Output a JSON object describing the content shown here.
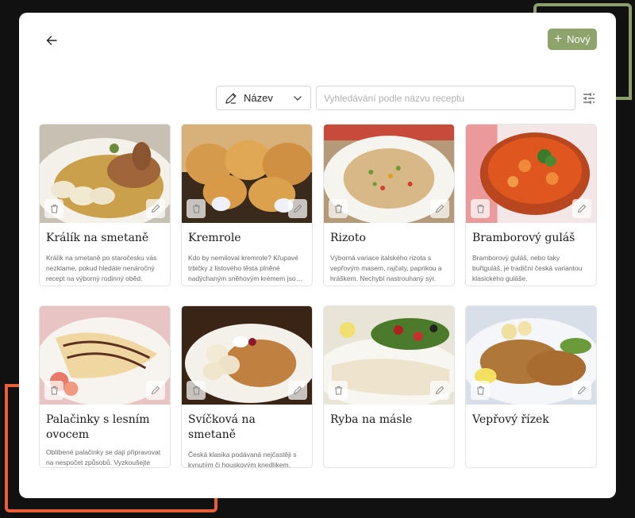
{
  "header": {
    "new_label": "Nový",
    "colors": {
      "accent": "#8fa36d",
      "deco_green": "#8da06b",
      "deco_orange": "#e8603a"
    }
  },
  "toolbar": {
    "sort_label": "Název",
    "search_placeholder": "Vyhledávání podle názvu receptu"
  },
  "recipes": [
    {
      "title": "Králík na smetaně",
      "description": "Králík na smetaně po staročesku vás nezklame, pokud hledáte nenáročný recept na výborný rodinný oběd."
    },
    {
      "title": "Kremrole",
      "description": "Kdo by nemiloval kremrole? Křupavé trbičky z listového těsta plněné nadýchaným sněhovým krémem jsou klasikou."
    },
    {
      "title": "Rizoto",
      "description": "Výborná variace italského rizota s vepřovým masem, rajčaty, paprikou a hráškem. Nechybí nastrouhaný sýr."
    },
    {
      "title": "Bramborový guláš",
      "description": "Bramborový guláš, nebo taky buřtguláš, je tradiční česká variantou klasického guláše."
    },
    {
      "title": "Palačinky s lesním ovocem",
      "description": "Oblíbené palačinky se dají připravovat na nespočet způsobů. Vyzkoušejte variantu s vanilkovým krémem."
    },
    {
      "title": "Svíčková na smetaně",
      "description": "Česká klasika podávaná nejčastěji s kynutým či houskovým knedlíkem. Díky restované zelenině a citrónové šťávě."
    },
    {
      "title": "Ryba na másle",
      "description": ""
    },
    {
      "title": "Vepřový řízek",
      "description": ""
    }
  ]
}
